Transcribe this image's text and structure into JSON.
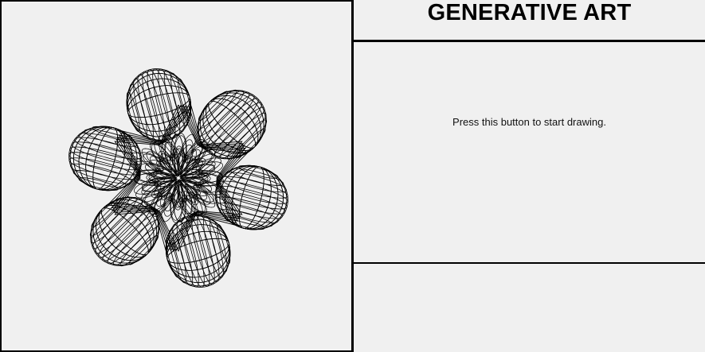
{
  "app": {
    "title": "GENERATIVE ART"
  },
  "controls": {
    "instruction_text": "Press this button to start drawing."
  },
  "art": {
    "description_type": "spirograph-flower",
    "stroke_color": "#000000",
    "background_color": "#f0f0f0",
    "petals": 6
  }
}
